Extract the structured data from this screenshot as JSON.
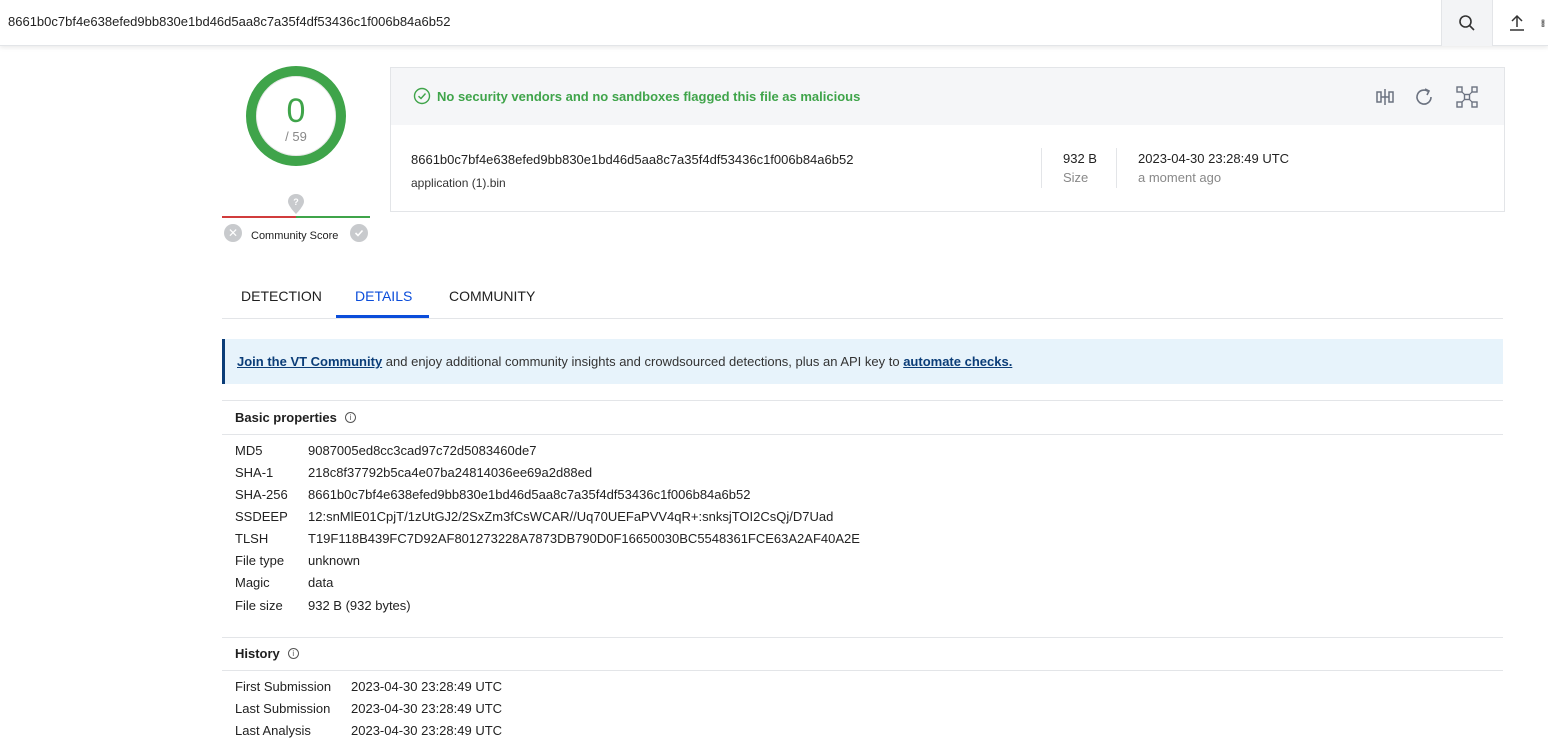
{
  "search": {
    "value": "8661b0c7bf4e638efed9bb830e1bd46d5aa8c7a35f4df53436c1f006b84a6b52",
    "search_icon": "search-icon",
    "upload_icon": "upload-icon",
    "more_icon": "grid-icon"
  },
  "score": {
    "detections": "0",
    "total": "/ 59",
    "community_label": "Community Score",
    "color": "#3fa44a"
  },
  "summary": {
    "verdict": "No security vendors and no sandboxes flagged this file as malicious",
    "hash": "8661b0c7bf4e638efed9bb830e1bd46d5aa8c7a35f4df53436c1f006b84a6b52",
    "file_name": "application (1).bin",
    "size_value": "932 B",
    "size_label": "Size",
    "date": "2023-04-30 23:28:49 UTC",
    "date_relative": "a moment ago",
    "actions": [
      "compare-icon",
      "reanalyze-icon",
      "graph-icon"
    ]
  },
  "tabs": [
    {
      "label": "DETECTION",
      "active": false
    },
    {
      "label": "DETAILS",
      "active": true
    },
    {
      "label": "COMMUNITY",
      "active": false
    }
  ],
  "banner": {
    "link1": "Join the VT Community",
    "middle": " and enjoy additional community insights and crowdsourced detections, plus an API key to ",
    "link2": "automate checks."
  },
  "basic_properties": {
    "title": "Basic properties",
    "rows": [
      {
        "key": "MD5",
        "value": "9087005ed8cc3cad97c72d5083460de7"
      },
      {
        "key": "SHA-1",
        "value": "218c8f37792b5ca4e07ba24814036ee69a2d88ed"
      },
      {
        "key": "SHA-256",
        "value": "8661b0c7bf4e638efed9bb830e1bd46d5aa8c7a35f4df53436c1f006b84a6b52"
      },
      {
        "key": "SSDEEP",
        "value": "12:snMlE01CpjT/1zUtGJ2/2SxZm3fCsWCAR//Uq70UEFaPVV4qR+:snksjTOI2CsQj/D7Uad"
      },
      {
        "key": "TLSH",
        "value": "T19F118B439FC7D92AF801273228A7873DB790D0F16650030BC5548361FCE63A2AF40A2E"
      },
      {
        "key": "File type",
        "value": "unknown"
      },
      {
        "key": "Magic",
        "value": "data"
      },
      {
        "key": "File size",
        "value": "932 B (932 bytes)"
      }
    ]
  },
  "history": {
    "title": "History",
    "rows": [
      {
        "key": "First Submission",
        "value": "2023-04-30 23:28:49 UTC"
      },
      {
        "key": "Last Submission",
        "value": "2023-04-30 23:28:49 UTC"
      },
      {
        "key": "Last Analysis",
        "value": "2023-04-30 23:28:49 UTC"
      }
    ]
  }
}
